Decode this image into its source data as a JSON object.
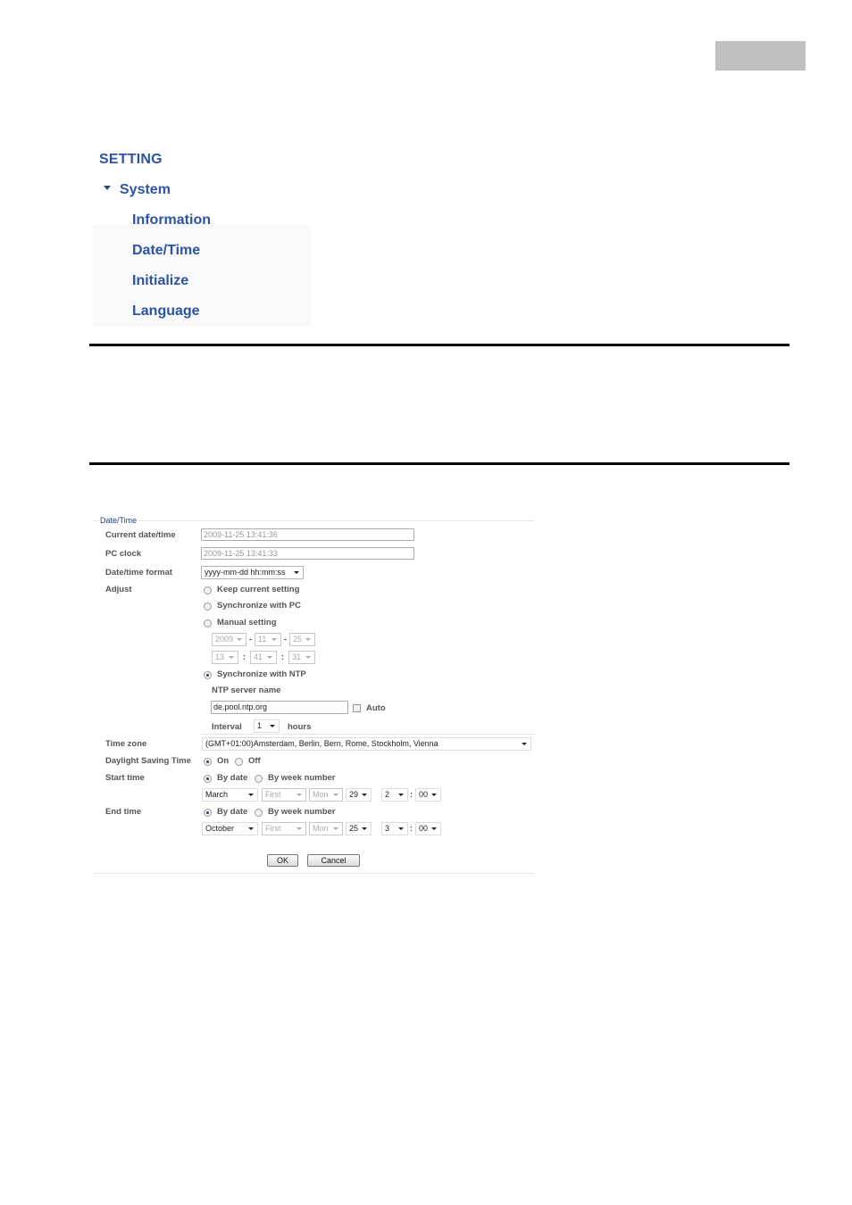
{
  "menu": {
    "title": "SETTING",
    "section": "System",
    "items": [
      "Information",
      "Date/Time",
      "Initialize",
      "Language"
    ]
  },
  "form": {
    "legend": "Date/Time",
    "labels": {
      "current": "Current date/time",
      "pc_clock": "PC clock",
      "format": "Date/time format",
      "adjust": "Adjust",
      "timezone": "Time zone",
      "dst": "Daylight Saving Time",
      "start": "Start time",
      "end": "End time"
    },
    "current_value": "2009-11-25   13:41:36",
    "pc_clock_value": "2009-11-25   13:41:33",
    "format_value": "yyyy-mm-dd hh:mm:ss",
    "adjust_options": {
      "keep": "Keep current setting",
      "sync_pc": "Synchronize with PC",
      "manual": "Manual setting",
      "ntp": "Synchronize with NTP",
      "selected": "ntp"
    },
    "manual": {
      "year": "2009",
      "month": "11",
      "day": "25",
      "hour": "13",
      "minute": "41",
      "second": "31",
      "date_sep": "-",
      "time_sep": ":"
    },
    "ntp": {
      "server_label": "NTP server name",
      "server_value": "de.pool.ntp.org",
      "auto_label": "Auto",
      "auto_checked": false,
      "interval_label": "Interval",
      "interval_value": "1",
      "interval_unit": "hours"
    },
    "timezone_value": "(GMT+01:00)Amsterdam, Berlin, Bern, Rome, Stockholm, Vienna",
    "dst": {
      "on": "On",
      "off": "Off",
      "selected": "on"
    },
    "start": {
      "by_date": "By date",
      "by_week": "By week number",
      "selected": "by_date",
      "month": "March",
      "week": "First",
      "weekday": "Mon",
      "day": "29",
      "hour": "2",
      "minute": "00"
    },
    "end": {
      "by_date": "By date",
      "by_week": "By week number",
      "selected": "by_date",
      "month": "October",
      "week": "First",
      "weekday": "Mon",
      "day": "25",
      "hour": "3",
      "minute": "00"
    },
    "buttons": {
      "ok": "OK",
      "cancel": "Cancel"
    }
  }
}
